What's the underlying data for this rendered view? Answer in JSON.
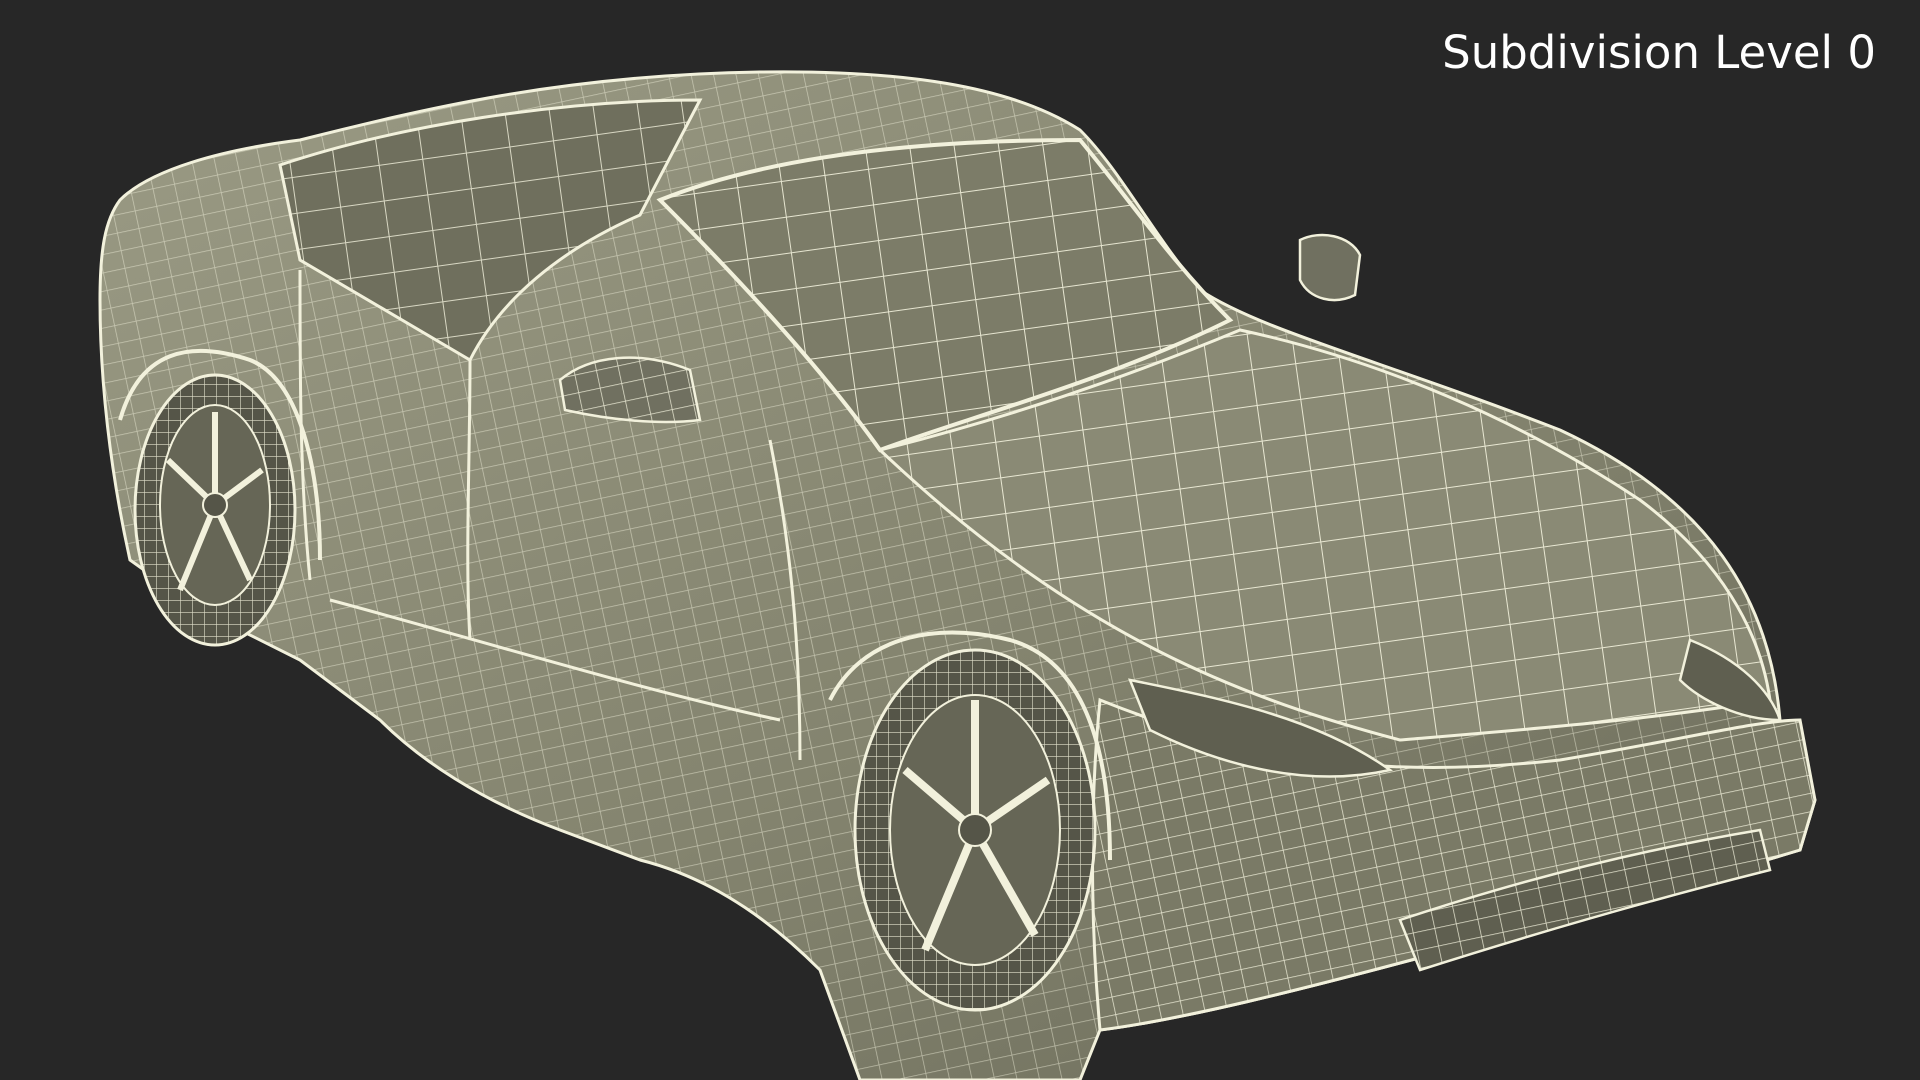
{
  "viewport": {
    "background": "#272727",
    "overlay_label": "Subdivision Level 0"
  },
  "model": {
    "subject": "car-wireframe",
    "surface_color": "#84846f",
    "surface_dark": "#5f5f50",
    "surface_light": "#9a9a84",
    "wire_color": "#f2f1dc",
    "wheel_color": "#555548"
  }
}
